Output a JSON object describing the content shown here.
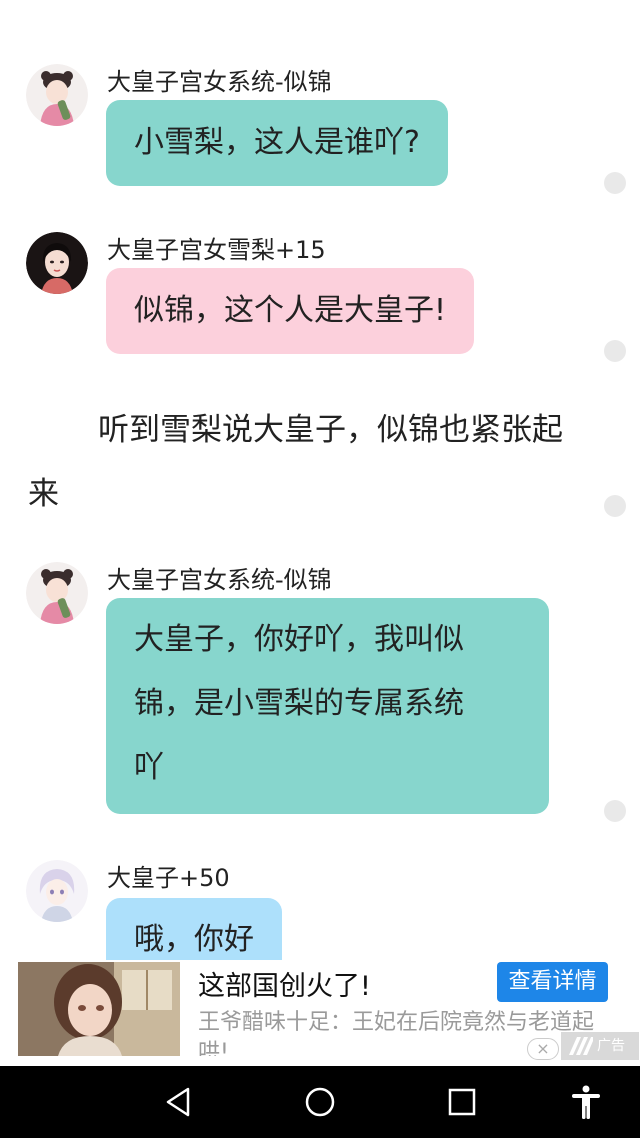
{
  "chat": {
    "messages": [
      {
        "sender": "大皇子宫女系统-似锦",
        "text": "小雪梨，这人是谁吖?"
      },
      {
        "sender": "大皇子宫女雪梨+15",
        "text": "似锦，这个人是大皇子!"
      },
      {
        "sender": "大皇子宫女系统-似锦",
        "text_lines": [
          "大皇子，你好吖，我叫似",
          "锦，是小雪梨的专属系统",
          "吖"
        ]
      },
      {
        "sender": "大皇子+50",
        "text": "哦，你好"
      }
    ],
    "narration": "听到雪梨说大皇子，似锦也紧张起来"
  },
  "ad": {
    "title": "这部国创火了!",
    "cta_label": "查看详情",
    "description": "王爷醋味十足：王妃在后院竟然与老道起哄!",
    "close_symbol": "×",
    "label": "广告"
  },
  "colors": {
    "bubble_teal": "#87d6cd",
    "bubble_pink": "#fcd0dc",
    "bubble_blue": "#ade0fb",
    "cta_blue": "#1e86e8",
    "nav_bg": "#000000"
  },
  "icons": [
    "avatar-sijin",
    "avatar-xueli",
    "avatar-prince",
    "back-icon",
    "home-icon",
    "recents-icon",
    "accessibility-icon"
  ]
}
